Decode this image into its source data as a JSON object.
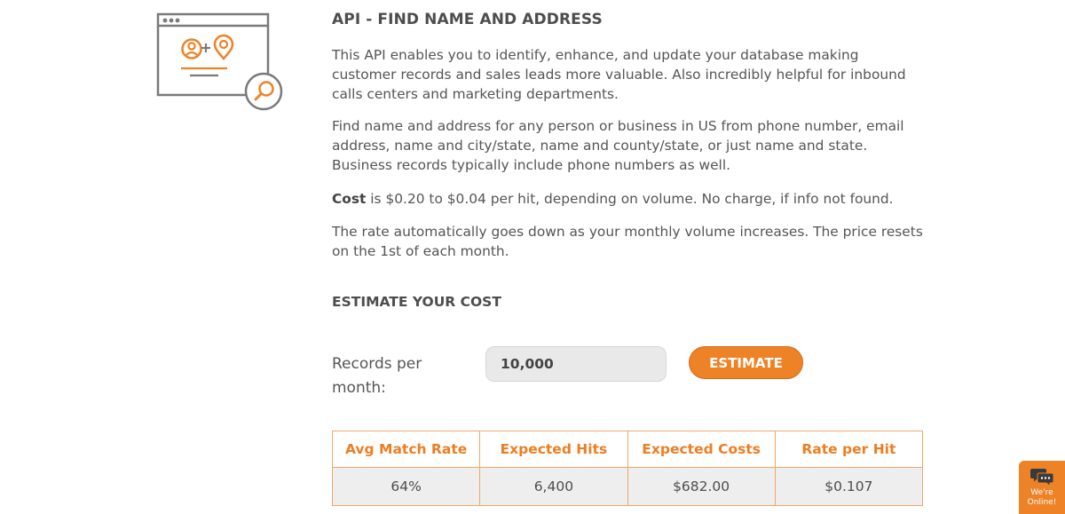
{
  "colors": {
    "accent": "#ee8227",
    "icon_gray": "#7a7a7a",
    "table_border": "#f0a868",
    "input_bg": "#e9e9e9",
    "row_bg": "#eeeeee"
  },
  "illustration": {
    "icon_name": "browser-window-contact-location-search-illustration"
  },
  "header": {
    "title": "API - FIND NAME AND ADDRESS"
  },
  "description": {
    "para1": "This API enables you to identify, enhance, and update your database making customer records and sales leads more valuable. Also incredibly helpful for inbound calls centers and marketing departments.",
    "para2": "Find name and address for any person or business in US from phone number, email address, name and city/state, name and county/state, or just name and state. Business records typically include phone numbers as well.",
    "cost_label": "Cost",
    "cost_text": " is $0.20 to $0.04 per hit, depending on volume. No charge, if info not found.",
    "rate_text": "The rate automatically goes down as your monthly volume increases. The price resets on the 1st of each month."
  },
  "estimator": {
    "heading": "ESTIMATE YOUR COST",
    "records_label": "Records per month:",
    "records_value": "10,000",
    "button_label": "ESTIMATE"
  },
  "results": {
    "headers": [
      "Avg Match Rate",
      "Expected Hits",
      "Expected Costs",
      "Rate per Hit"
    ],
    "row": [
      "64%",
      "6,400",
      "$682.00",
      "$0.107"
    ]
  },
  "chat": {
    "icon_name": "chat-bubbles-icon",
    "text_line1": "We're",
    "text_line2": "Online!"
  }
}
